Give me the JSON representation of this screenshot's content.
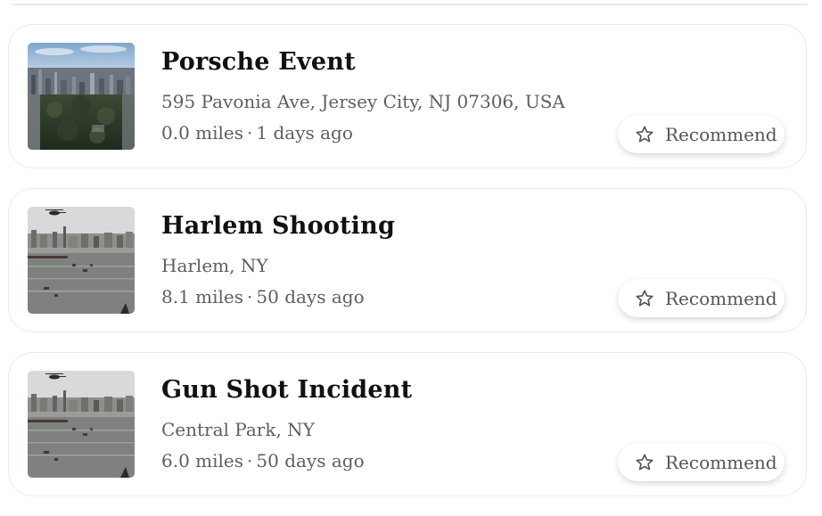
{
  "incidents": [
    {
      "title": "Porsche Event",
      "address": "595 Pavonia Ave, Jersey City, NJ 07306, USA",
      "distance": "0.0 miles",
      "separator": "·",
      "age": "1 days ago",
      "recommend_label": "Recommend",
      "thumbnail": "city-aerial-park"
    },
    {
      "title": "Harlem Shooting",
      "address": "Harlem, NY",
      "distance": "8.1 miles",
      "separator": "·",
      "age": "50 days ago",
      "recommend_label": "Recommend",
      "thumbnail": "river-helicopter"
    },
    {
      "title": "Gun Shot Incident",
      "address": "Central Park, NY",
      "distance": "6.0 miles",
      "separator": "·",
      "age": "50 days ago",
      "recommend_label": "Recommend",
      "thumbnail": "river-helicopter"
    }
  ],
  "icons": {
    "recommend": "star-icon"
  },
  "colors": {
    "title": "#111111",
    "secondary_text": "#5e5e5e",
    "card_border": "#ececec"
  }
}
